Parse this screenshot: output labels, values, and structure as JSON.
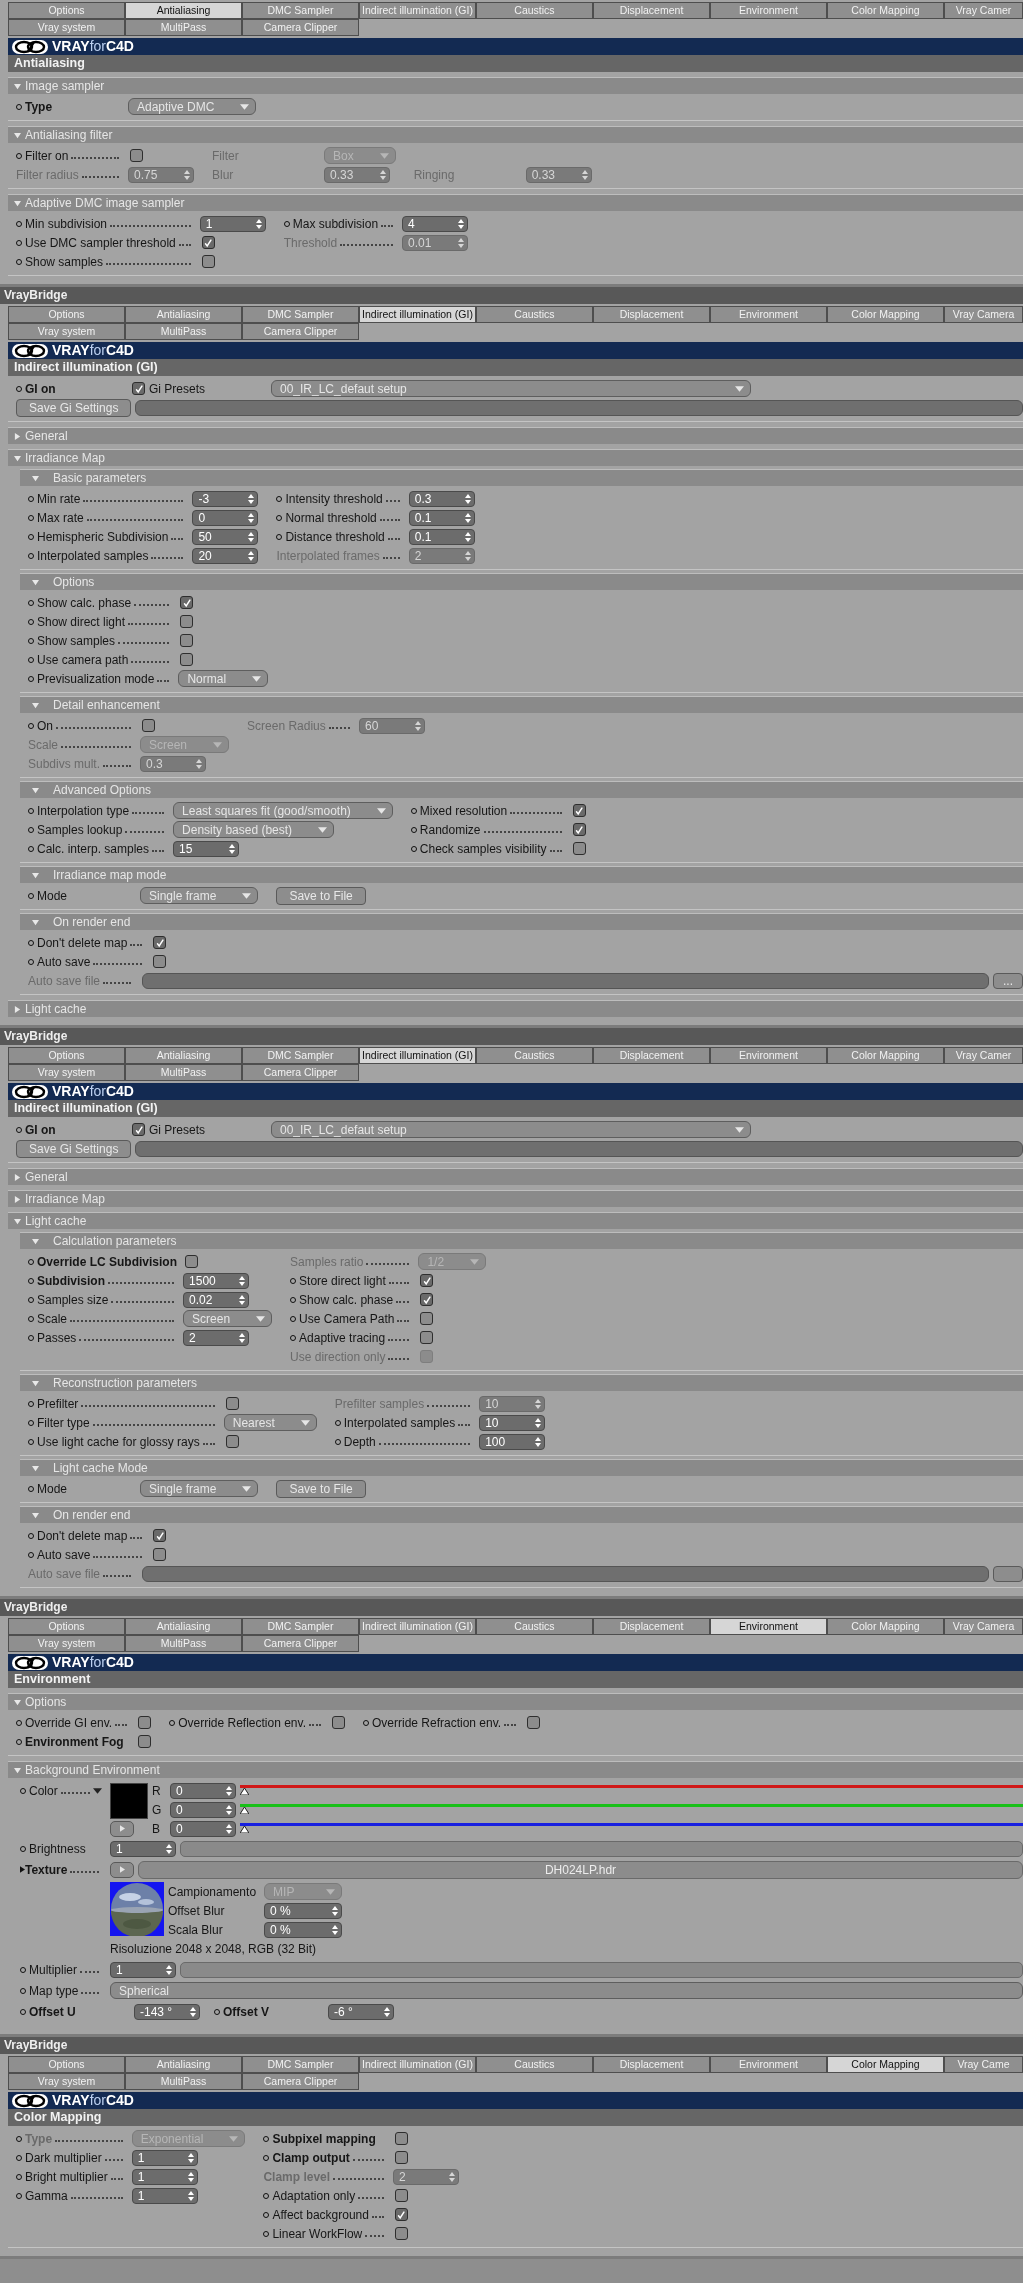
{
  "panels": [
    {
      "tabs": [
        [
          {
            "label": "Options",
            "selected": false
          },
          {
            "label": "Antialiasing",
            "selected": true
          },
          {
            "label": "DMC Sampler",
            "selected": false
          },
          {
            "label": "Indirect illumination (GI)",
            "selected": false
          },
          {
            "label": "Caustics",
            "selected": false
          },
          {
            "label": "Displacement",
            "selected": false
          },
          {
            "label": "Environment",
            "selected": false
          },
          {
            "label": "Color Mapping",
            "selected": false
          },
          {
            "label": "Vray Camer",
            "selected": false
          }
        ],
        [
          {
            "label": "Vray system",
            "selected": false
          },
          {
            "label": "MultiPass",
            "selected": false
          },
          {
            "label": "Camera Clipper",
            "selected": false
          }
        ]
      ],
      "logo": "**VRAY**for**C4D**",
      "section": "Antialiasing",
      "groups": [
        {
          "title": "Image sampler",
          "expanded": true,
          "rows": [
            [
              {
                "kind": "select",
                "label": "Type",
                "value": "Adaptive DMC",
                "dot": true,
                "bold": true
              }
            ]
          ]
        },
        {
          "title": "Antialiasing filter",
          "expanded": true,
          "rows": [
            [
              {
                "kind": "check",
                "label": "Filter on",
                "checked": false,
                "dot": true,
                "dots": true
              },
              {
                "kind": "select",
                "label": "Filter",
                "value": "Box",
                "disabled": true
              }
            ],
            [
              {
                "kind": "number",
                "label": "Filter radius",
                "value": "0.75",
                "disabled": true,
                "dots": true
              },
              {
                "kind": "number",
                "label": "Blur",
                "value": "0.33",
                "disabled": true
              },
              {
                "kind": "number",
                "label": "Ringing",
                "value": "0.33",
                "disabled": true
              }
            ]
          ]
        },
        {
          "title": "Adaptive DMC image sampler",
          "expanded": true,
          "rows": [
            [
              {
                "kind": "number",
                "label": "Min subdivision",
                "value": "1",
                "dot": true,
                "dots": true
              },
              {
                "kind": "number",
                "label": "Max subdivision",
                "value": "4",
                "dot": true,
                "dots": true
              }
            ],
            [
              {
                "kind": "check",
                "label": "Use DMC sampler threshold",
                "checked": true,
                "dot": true,
                "dots": true
              },
              {
                "kind": "number",
                "label": "Threshold",
                "value": "0.01",
                "disabled": true,
                "dots": true
              }
            ],
            [
              {
                "kind": "check",
                "label": "Show samples",
                "checked": false,
                "dot": true,
                "dots": true
              }
            ]
          ]
        }
      ]
    },
    {
      "title": "VrayBridge",
      "tabs": [
        [
          {
            "label": "Options",
            "selected": false
          },
          {
            "label": "Antialiasing",
            "selected": false
          },
          {
            "label": "DMC Sampler",
            "selected": false
          },
          {
            "label": "Indirect illumination (GI)",
            "selected": true
          },
          {
            "label": "Caustics",
            "selected": false
          },
          {
            "label": "Displacement",
            "selected": false
          },
          {
            "label": "Environment",
            "selected": false
          },
          {
            "label": "Color Mapping",
            "selected": false
          },
          {
            "label": "Vray Camera",
            "selected": false
          }
        ],
        [
          {
            "label": "Vray system",
            "selected": false
          },
          {
            "label": "MultiPass",
            "selected": false
          },
          {
            "label": "Camera Clipper",
            "selected": false
          }
        ]
      ],
      "logo": "**VRAY**for**C4D**",
      "section": "Indirect illumination (GI)",
      "groups": [
        {
          "rows": [
            [
              {
                "kind": "check",
                "label": "GI on",
                "checked": true,
                "dot": true,
                "bold": true
              },
              {
                "kind": "preset",
                "label": "Gi Presets",
                "value": "00_IR_LC_defaut setup"
              }
            ],
            [
              {
                "kind": "button",
                "label": "Save Gi Settings"
              },
              {
                "kind": "path"
              }
            ]
          ]
        },
        {
          "title": "General",
          "expanded": false
        },
        {
          "title": "Irradiance Map",
          "expanded": true,
          "children": [
            {
              "title": "Basic parameters",
              "expanded": true,
              "rows": [
                [
                  {
                    "kind": "number",
                    "label": "Min rate",
                    "value": "-3",
                    "dot": true,
                    "dots": true
                  },
                  {
                    "kind": "number",
                    "label": "Intensity threshold",
                    "value": "0.3",
                    "dot": true,
                    "dots": true
                  }
                ],
                [
                  {
                    "kind": "number",
                    "label": "Max rate",
                    "value": "0",
                    "dot": true,
                    "dots": true
                  },
                  {
                    "kind": "number",
                    "label": "Normal threshold",
                    "value": "0.1",
                    "dot": true,
                    "dots": true
                  }
                ],
                [
                  {
                    "kind": "number",
                    "label": "Hemispheric Subdivision",
                    "value": "50",
                    "dot": true,
                    "dots": true
                  },
                  {
                    "kind": "number",
                    "label": "Distance threshold",
                    "value": "0.1",
                    "dot": true,
                    "dots": true
                  }
                ],
                [
                  {
                    "kind": "number",
                    "label": "Interpolated samples",
                    "value": "20",
                    "dot": true,
                    "dots": true
                  },
                  {
                    "kind": "number",
                    "label": "Interpolated frames",
                    "value": "2",
                    "disabled": true,
                    "dots": true
                  }
                ]
              ]
            },
            {
              "title": "Options",
              "expanded": true,
              "rows": [
                [
                  {
                    "kind": "check",
                    "label": "Show calc. phase",
                    "checked": true,
                    "dot": true,
                    "dots": true
                  }
                ],
                [
                  {
                    "kind": "check",
                    "label": "Show direct light",
                    "checked": false,
                    "dot": true,
                    "dots": true
                  }
                ],
                [
                  {
                    "kind": "check",
                    "label": "Show samples",
                    "checked": false,
                    "dot": true,
                    "dots": true
                  }
                ],
                [
                  {
                    "kind": "check",
                    "label": "Use camera path",
                    "checked": false,
                    "dot": true,
                    "dots": true
                  }
                ],
                [
                  {
                    "kind": "select",
                    "label": "Previsualization mode",
                    "value": "Normal",
                    "dot": true,
                    "dots": true
                  }
                ]
              ]
            },
            {
              "title": "Detail enhancement",
              "expanded": true,
              "rows": [
                [
                  {
                    "kind": "check",
                    "label": "On",
                    "checked": false,
                    "dot": true,
                    "dots": true
                  },
                  {
                    "kind": "number",
                    "label": "Screen Radius",
                    "value": "60",
                    "disabled": true,
                    "dots": true
                  }
                ],
                [
                  {
                    "kind": "select",
                    "label": "Scale",
                    "value": "Screen",
                    "disabled": true,
                    "dots": true
                  }
                ],
                [
                  {
                    "kind": "number",
                    "label": "Subdivs mult.",
                    "value": "0.3",
                    "disabled": true,
                    "dots": true
                  }
                ]
              ]
            },
            {
              "title": "Advanced Options",
              "expanded": true,
              "rows": [
                [
                  {
                    "kind": "select",
                    "label": "Interpolation type",
                    "value": "Least squares fit (good/smooth)",
                    "dot": true,
                    "dots": true
                  },
                  {
                    "kind": "check",
                    "label": "Mixed resolution",
                    "checked": true,
                    "dot": true,
                    "dots": true
                  }
                ],
                [
                  {
                    "kind": "select",
                    "label": "Samples lookup",
                    "value": "Density based (best)",
                    "dot": true,
                    "dots": true
                  },
                  {
                    "kind": "check",
                    "label": "Randomize",
                    "checked": true,
                    "dot": true,
                    "dots": true
                  }
                ],
                [
                  {
                    "kind": "number",
                    "label": "Calc. interp. samples",
                    "value": "15",
                    "dot": true,
                    "dots": true
                  },
                  {
                    "kind": "check",
                    "label": "Check samples visibility",
                    "checked": false,
                    "dot": true,
                    "dots": true
                  }
                ]
              ]
            },
            {
              "title": "Irradiance map mode",
              "expanded": true,
              "rows": [
                [
                  {
                    "kind": "select",
                    "label": "Mode",
                    "value": "Single frame",
                    "dot": true
                  },
                  {
                    "kind": "button",
                    "label": "Save to File"
                  }
                ]
              ]
            },
            {
              "title": "On render end",
              "expanded": true,
              "rows": [
                [
                  {
                    "kind": "check",
                    "label": "Don't delete map",
                    "checked": true,
                    "dot": true,
                    "dots": true
                  }
                ],
                [
                  {
                    "kind": "check",
                    "label": "Auto save",
                    "checked": false,
                    "dot": true,
                    "dots": true
                  }
                ],
                [
                  {
                    "kind": "path",
                    "label": "Auto save file",
                    "disabled": true,
                    "dots": true
                  },
                  {
                    "kind": "browse",
                    "label": "..."
                  }
                ]
              ]
            }
          ]
        },
        {
          "title": "Light cache",
          "expanded": false
        }
      ]
    },
    {
      "title": "VrayBridge",
      "tabs": [
        [
          {
            "label": "Options",
            "selected": false
          },
          {
            "label": "Antialiasing",
            "selected": false
          },
          {
            "label": "DMC Sampler",
            "selected": false
          },
          {
            "label": "Indirect illumination (GI)",
            "selected": true
          },
          {
            "label": "Caustics",
            "selected": false
          },
          {
            "label": "Displacement",
            "selected": false
          },
          {
            "label": "Environment",
            "selected": false
          },
          {
            "label": "Color Mapping",
            "selected": false
          },
          {
            "label": "Vray Camer",
            "selected": false
          }
        ],
        [
          {
            "label": "Vray system",
            "selected": false
          },
          {
            "label": "MultiPass",
            "selected": false
          },
          {
            "label": "Camera Clipper",
            "selected": false
          }
        ]
      ],
      "logo": "**VRAY**for**C4D**",
      "section": "Indirect illumination (GI)",
      "groups": [
        {
          "rows": [
            [
              {
                "kind": "check",
                "label": "GI on",
                "checked": true,
                "dot": true,
                "bold": true
              },
              {
                "kind": "preset",
                "label": "Gi Presets",
                "value": "00_IR_LC_defaut setup"
              }
            ],
            [
              {
                "kind": "button",
                "label": "Save Gi Settings"
              },
              {
                "kind": "path"
              }
            ]
          ]
        },
        {
          "title": "General",
          "expanded": false
        },
        {
          "title": "Irradiance Map",
          "expanded": false
        },
        {
          "title": "Light cache",
          "expanded": true,
          "children": [
            {
              "title": "Calculation parameters",
              "expanded": true,
              "rows": [
                [
                  {
                    "kind": "check",
                    "label": "Override LC Subdivision",
                    "checked": false,
                    "dot": true,
                    "bold": true
                  },
                  {
                    "kind": "select",
                    "label": "Samples ratio",
                    "value": "1/2",
                    "disabled": true,
                    "dots": true
                  }
                ],
                [
                  {
                    "kind": "number",
                    "label": "Subdivision",
                    "value": "1500",
                    "dot": true,
                    "dots": true,
                    "bold": true
                  },
                  {
                    "kind": "check",
                    "label": "Store direct light",
                    "checked": true,
                    "dot": true,
                    "dots": true
                  }
                ],
                [
                  {
                    "kind": "number",
                    "label": "Samples size",
                    "value": "0.02",
                    "dot": true,
                    "dots": true
                  },
                  {
                    "kind": "check",
                    "label": "Show calc. phase",
                    "checked": true,
                    "dot": true,
                    "dots": true
                  }
                ],
                [
                  {
                    "kind": "select",
                    "label": "Scale",
                    "value": "Screen",
                    "dot": true,
                    "dots": true
                  },
                  {
                    "kind": "check",
                    "label": "Use Camera Path",
                    "checked": false,
                    "dot": true,
                    "dots": true
                  }
                ],
                [
                  {
                    "kind": "number",
                    "label": "Passes",
                    "value": "2",
                    "dot": true,
                    "dots": true
                  },
                  {
                    "kind": "check",
                    "label": "Adaptive tracing",
                    "checked": false,
                    "dot": true,
                    "dots": true
                  }
                ],
                [
                  null,
                  {
                    "kind": "check",
                    "label": "Use direction only",
                    "checked": false,
                    "disabled": true,
                    "dots": true
                  }
                ]
              ]
            },
            {
              "title": "Reconstruction parameters",
              "expanded": true,
              "rows": [
                [
                  {
                    "kind": "check",
                    "label": "Prefilter",
                    "checked": false,
                    "dot": true,
                    "dots": true
                  },
                  {
                    "kind": "number",
                    "label": "Prefilter samples",
                    "value": "10",
                    "disabled": true,
                    "dots": true
                  }
                ],
                [
                  {
                    "kind": "select",
                    "label": "Filter type",
                    "value": "Nearest",
                    "dot": true,
                    "dots": true
                  },
                  {
                    "kind": "number",
                    "label": "Interpolated samples",
                    "value": "10",
                    "dot": true,
                    "dots": true
                  }
                ],
                [
                  {
                    "kind": "check",
                    "label": "Use light cache for glossy rays",
                    "checked": false,
                    "dot": true,
                    "dots": true
                  },
                  {
                    "kind": "number",
                    "label": "Depth",
                    "value": "100",
                    "dot": true,
                    "dots": true
                  }
                ]
              ]
            },
            {
              "title": "Light cache Mode",
              "expanded": true,
              "rows": [
                [
                  {
                    "kind": "select",
                    "label": "Mode",
                    "value": "Single frame",
                    "dot": true
                  },
                  {
                    "kind": "button",
                    "label": "Save to File"
                  }
                ]
              ]
            },
            {
              "title": "On render end",
              "expanded": true,
              "rows": [
                [
                  {
                    "kind": "check",
                    "label": "Don't delete map",
                    "checked": true,
                    "dot": true,
                    "dots": true
                  }
                ],
                [
                  {
                    "kind": "check",
                    "label": "Auto save",
                    "checked": false,
                    "dot": true,
                    "dots": true
                  }
                ],
                [
                  {
                    "kind": "path",
                    "label": "Auto save file",
                    "disabled": true,
                    "dots": true
                  },
                  {
                    "kind": "browse"
                  }
                ]
              ]
            }
          ]
        }
      ]
    },
    {
      "title": "VrayBridge",
      "tabs": [
        [
          {
            "label": "Options",
            "selected": false
          },
          {
            "label": "Antialiasing",
            "selected": false
          },
          {
            "label": "DMC Sampler",
            "selected": false
          },
          {
            "label": "Indirect illumination (GI)",
            "selected": false
          },
          {
            "label": "Caustics",
            "selected": false
          },
          {
            "label": "Displacement",
            "selected": false
          },
          {
            "label": "Environment",
            "selected": true
          },
          {
            "label": "Color Mapping",
            "selected": false
          },
          {
            "label": "Vray Camera",
            "selected": false
          }
        ],
        [
          {
            "label": "Vray system",
            "selected": false
          },
          {
            "label": "MultiPass",
            "selected": false
          },
          {
            "label": "Camera Clipper",
            "selected": false
          }
        ]
      ],
      "logo": "**VRAY**for**C4D**",
      "section": "Environment",
      "groups": [
        {
          "title": "Options",
          "expanded": true,
          "rows": [
            [
              {
                "kind": "check",
                "label": "Override GI env.",
                "checked": false,
                "dot": true,
                "dots": true
              },
              {
                "kind": "check",
                "label": "Override Reflection env.",
                "checked": false,
                "dot": true,
                "dots": true
              },
              {
                "kind": "check",
                "label": "Override Refraction env.",
                "checked": false,
                "dot": true,
                "dots": true
              }
            ],
            [
              {
                "kind": "check",
                "label": "Environment Fog",
                "checked": false,
                "dot": true,
                "bold": true
              }
            ]
          ]
        },
        {
          "title": "Background Environment",
          "expanded": true,
          "kind": "background",
          "color": {
            "label": "Color",
            "color": "#000000",
            "channels": [
              {
                "name": "R",
                "value": "0",
                "level": 0,
                "color": "#d01818"
              },
              {
                "name": "G",
                "value": "0",
                "level": 0,
                "color": "#18c018"
              },
              {
                "name": "B",
                "value": "0",
                "level": 0,
                "color": "#1820e0"
              }
            ]
          },
          "brightness": {
            "label": "Brightness",
            "value": "1"
          },
          "texture": {
            "label": "Texture",
            "file": "DH024LP.hdr",
            "sampling": {
              "label": "Campionamento",
              "value": "MIP"
            },
            "fields": [
              {
                "label": "Offset Blur",
                "value": "0 %"
              },
              {
                "label": "Scala Blur",
                "value": "0 %"
              }
            ],
            "info": "Risoluzione 2048 x 2048, RGB (32 Bit)"
          },
          "multiplier": {
            "label": "Multiplier",
            "value": "1"
          },
          "map_type": {
            "label": "Map type",
            "value": "Spherical"
          },
          "offsets": [
            {
              "label": "Offset U",
              "value": "-143 °"
            },
            {
              "label": "Offset V",
              "value": "-6 °"
            }
          ]
        }
      ]
    },
    {
      "title": "VrayBridge",
      "tabs": [
        [
          {
            "label": "Options",
            "selected": false
          },
          {
            "label": "Antialiasing",
            "selected": false
          },
          {
            "label": "DMC Sampler",
            "selected": false
          },
          {
            "label": "Indirect illumination (GI)",
            "selected": false
          },
          {
            "label": "Caustics",
            "selected": false
          },
          {
            "label": "Displacement",
            "selected": false
          },
          {
            "label": "Environment",
            "selected": false
          },
          {
            "label": "Color Mapping",
            "selected": true
          },
          {
            "label": "Vray Came",
            "selected": false
          }
        ],
        [
          {
            "label": "Vray system",
            "selected": false
          },
          {
            "label": "MultiPass",
            "selected": false
          },
          {
            "label": "Camera Clipper",
            "selected": false
          }
        ]
      ],
      "logo": "**VRAY**for**C4D**",
      "section": "Color Mapping",
      "groups": [
        {
          "rows": [
            [
              {
                "kind": "select",
                "label": "Type",
                "value": "Exponential",
                "disabled": true,
                "dot": true,
                "dots": true,
                "bold": true
              },
              {
                "kind": "check",
                "label": "Subpixel mapping",
                "checked": false,
                "dot": true,
                "bold": true
              }
            ],
            [
              {
                "kind": "number",
                "label": "Dark multiplier",
                "value": "1",
                "dot": true,
                "dots": true
              },
              {
                "kind": "check",
                "label": "Clamp output",
                "checked": false,
                "dot": true,
                "dots": true,
                "bold": true
              }
            ],
            [
              {
                "kind": "number",
                "label": "Bright multiplier",
                "value": "1",
                "dot": true,
                "dots": true
              },
              {
                "kind": "number",
                "label": "Clamp level",
                "value": "2",
                "disabled": true,
                "dots": true,
                "bold": true
              }
            ],
            [
              {
                "kind": "number",
                "label": "Gamma",
                "value": "1",
                "dot": true,
                "dots": true
              },
              {
                "kind": "check",
                "label": "Adaptation only",
                "checked": false,
                "dot": true,
                "dots": true
              }
            ],
            [
              null,
              {
                "kind": "check",
                "label": "Affect background",
                "checked": true,
                "dot": true,
                "dots": true
              }
            ],
            [
              null,
              {
                "kind": "check",
                "label": "Linear WorkFlow",
                "checked": false,
                "dot": true,
                "dots": true
              }
            ]
          ]
        }
      ]
    }
  ]
}
